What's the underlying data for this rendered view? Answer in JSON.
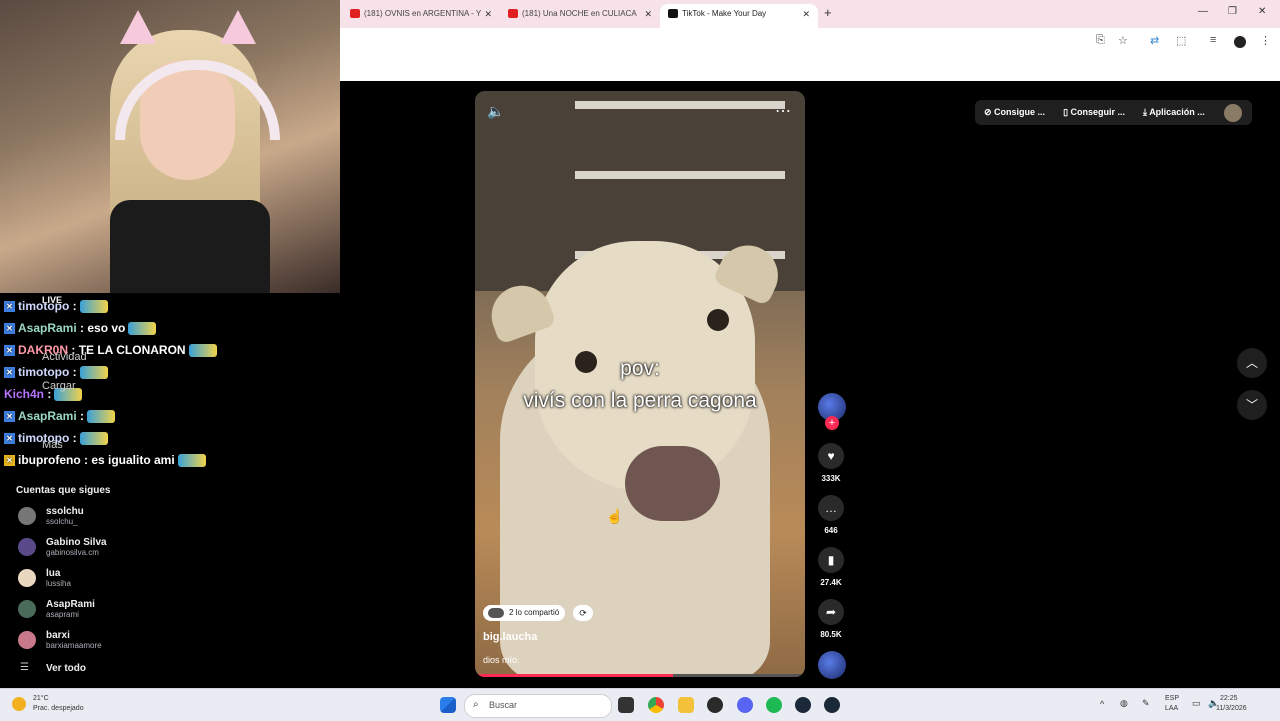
{
  "stream": {
    "live_label": "LIVE",
    "chat": [
      {
        "user": "timotopo",
        "text": "",
        "badge": "blue",
        "user_color": "#cfd8ff"
      },
      {
        "user": "AsapRami",
        "text": "eso vo",
        "badge": "blue",
        "user_color": "#9ad7c0"
      },
      {
        "user": "DAKR0N",
        "text": "TE LA CLONARON",
        "badge": "blue",
        "user_color": "#ff9aa8"
      },
      {
        "user": "timotopo",
        "text": "",
        "badge": "blue",
        "user_color": "#cfd8ff"
      },
      {
        "user": "Kich4n",
        "text": "",
        "badge": "none",
        "user_color": "#b673ff"
      },
      {
        "user": "AsapRami",
        "text": "",
        "badge": "blue",
        "user_color": "#9ad7c0"
      },
      {
        "user": "timotopo",
        "text": "",
        "badge": "blue",
        "user_color": "#cfd8ff"
      },
      {
        "user": "ibuprofeno",
        "text": "es igualito ami",
        "badge": "yellow",
        "user_color": "#ffffff"
      }
    ],
    "sidebar_ghost": [
      "Actividad",
      "Cargar",
      "Más"
    ],
    "following_title": "Cuentas que sigues",
    "following": [
      {
        "name": "ssolchu",
        "handle": "ssolchu_",
        "color": "#777777"
      },
      {
        "name": "Gabino Silva",
        "handle": "gabinosilva.cm",
        "color": "#5b4a8a"
      },
      {
        "name": "lua",
        "handle": "lussiha",
        "color": "#e8d8c0"
      },
      {
        "name": "AsapRami",
        "handle": "asaprami",
        "color": "#4a6a5a"
      },
      {
        "name": "barxi",
        "handle": "barxiamaamore",
        "color": "#c97a8a"
      }
    ],
    "see_all": "Ver todo"
  },
  "browser": {
    "tabs": [
      {
        "title": "(181) OVNIS en ARGENTINA - Y",
        "icon": "youtube-icon",
        "active": false
      },
      {
        "title": "(181) Una NOCHE en CULIACA",
        "icon": "youtube-icon",
        "active": false
      },
      {
        "title": "TikTok - Make Your Day",
        "icon": "tiktok-icon",
        "active": true
      }
    ],
    "new_tab": "+"
  },
  "tiktok": {
    "caption_line1": "pov:",
    "caption_line2": "vivís con la perra cagona",
    "shared_label": "2 lo compartió",
    "author": "big.laucha",
    "description": "dios mío.",
    "likes": "333K",
    "comments": "646",
    "saves": "27.4K",
    "shares": "80.5K",
    "progress": 0.6,
    "top_buttons": [
      "Consigue ...",
      "Conseguir ...",
      "Aplicación ..."
    ]
  },
  "taskbar": {
    "weather_temp": "21°C",
    "weather_desc": "Prac. despejado",
    "search_placeholder": "Buscar",
    "lang": "ESP",
    "lang_sub": "LAA",
    "time": "22:25",
    "date": "11/3/2026"
  }
}
